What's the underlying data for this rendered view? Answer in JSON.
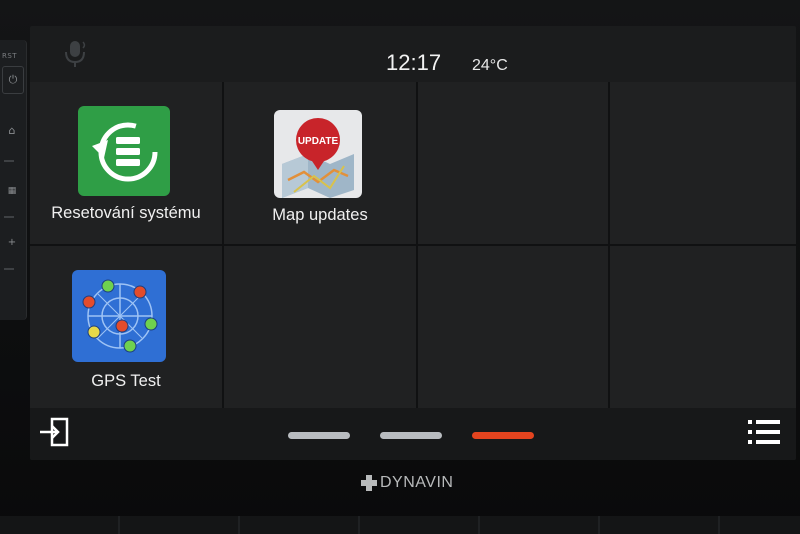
{
  "device": {
    "rst_label": "RST",
    "brand": "DYNAVIN"
  },
  "status_bar": {
    "time": "12:17",
    "temperature": "24°C"
  },
  "apps": [
    {
      "label": "Resetování systému",
      "icon": "system-reset-icon",
      "color": "#2ea043"
    },
    {
      "label": "Map updates",
      "icon": "map-update-icon",
      "color": "#e6e6e6"
    },
    {
      "label": "GPS Test",
      "icon": "gps-test-icon",
      "color": "#2e6fd6"
    }
  ],
  "pager": {
    "pages": 3,
    "active_page": 3,
    "inactive_color": "#b9bcc0",
    "active_color": "#e4441f"
  }
}
